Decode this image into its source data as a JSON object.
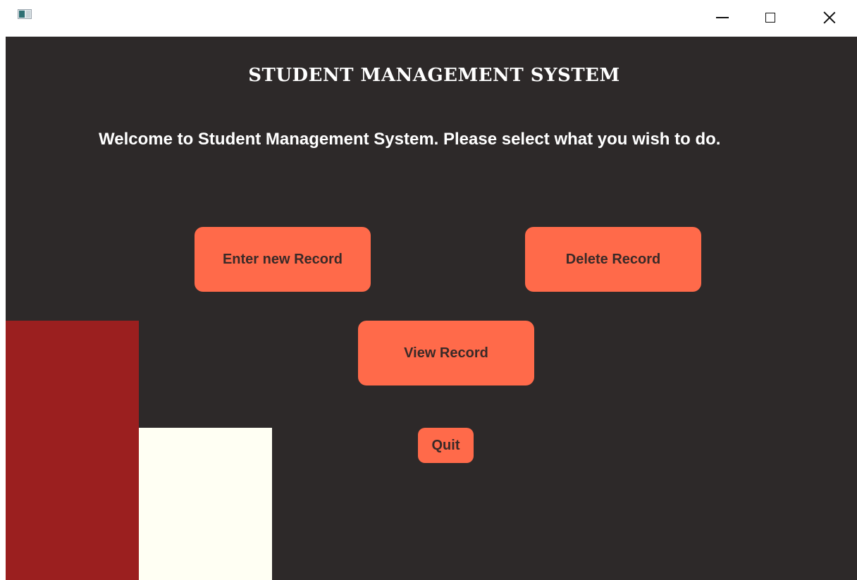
{
  "window": {
    "controls": {
      "minimize_icon": "minimize-icon",
      "maximize_icon": "maximize-icon",
      "close_icon": "close-icon"
    }
  },
  "app": {
    "title": "STUDENT MANAGEMENT SYSTEM",
    "welcome": "Welcome to Student Management System. Please select what you wish to do."
  },
  "buttons": {
    "enter": "Enter new Record",
    "delete": "Delete Record",
    "view": "View Record",
    "quit": "Quit"
  },
  "colors": {
    "background": "#2d2929",
    "button": "#ff6a4a",
    "button_text": "#3a2a28",
    "red_block": "#9b1f1f",
    "cream_block": "#fffff3"
  }
}
